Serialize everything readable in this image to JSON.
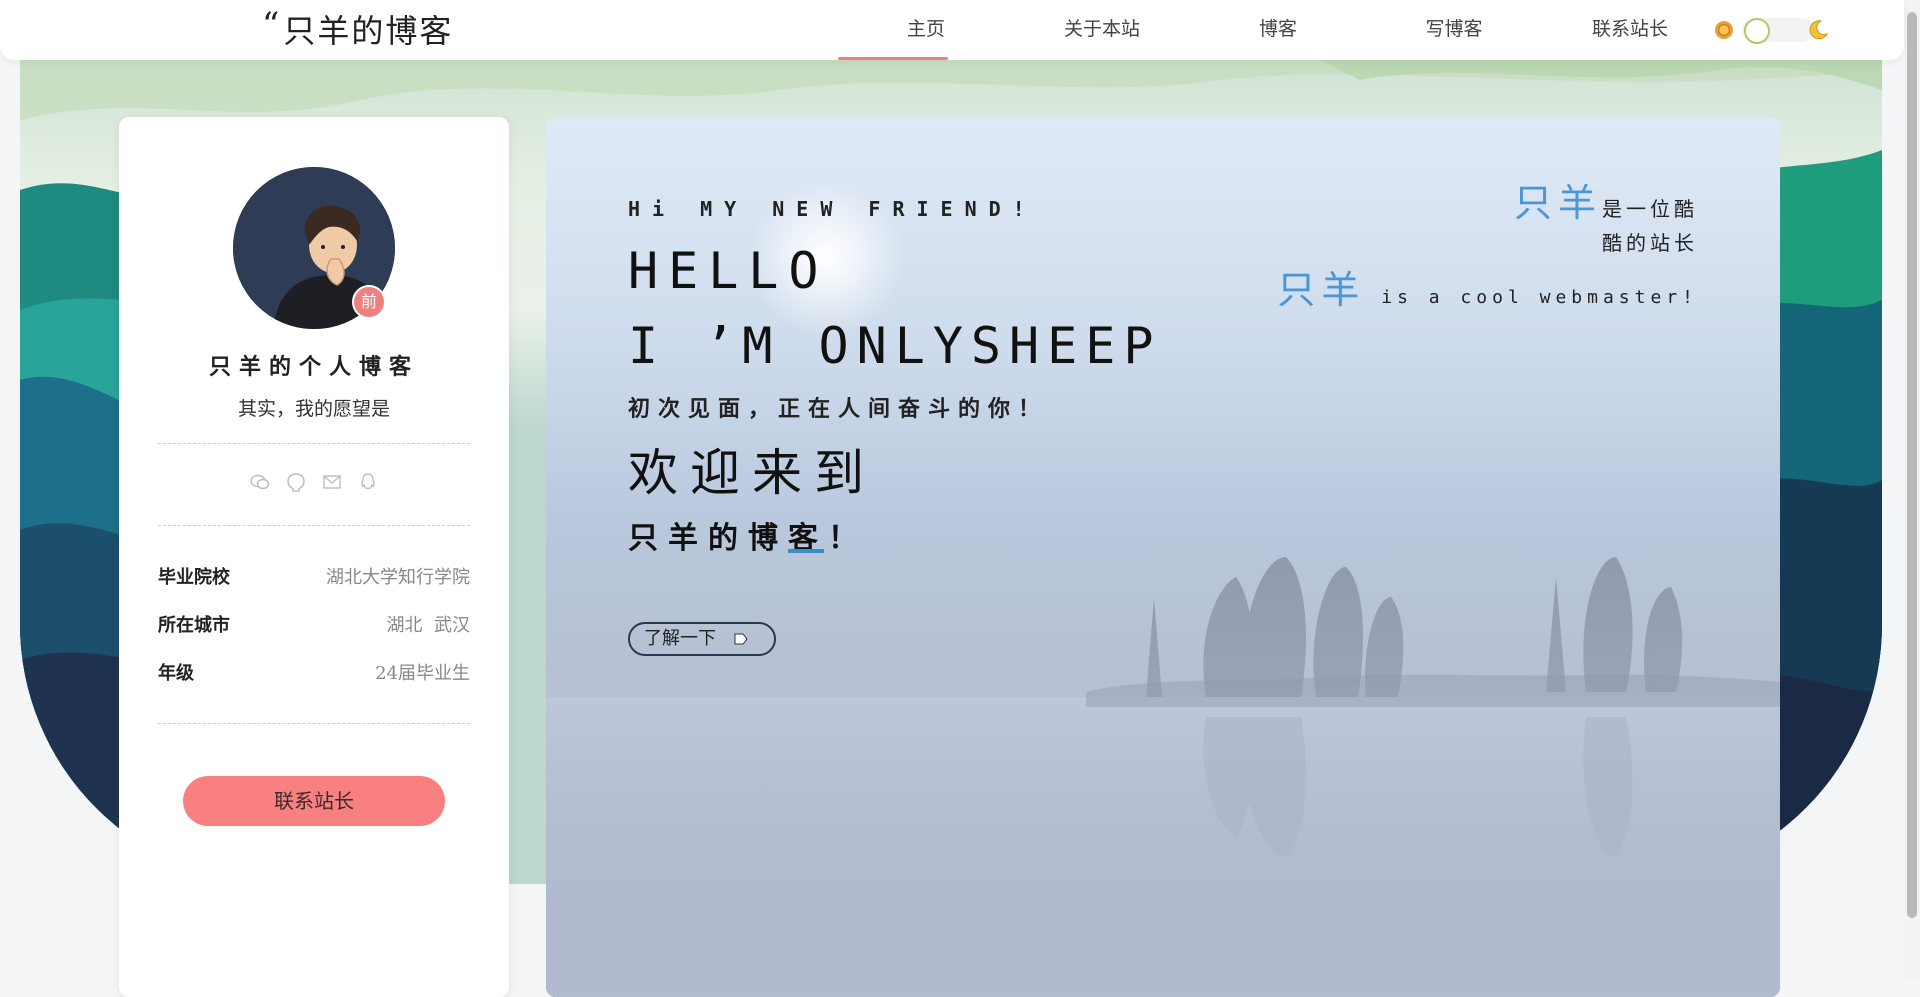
{
  "header": {
    "logo_quote": "“",
    "logo_text": "只羊的博客",
    "nav": [
      {
        "label": "主页",
        "active": true
      },
      {
        "label": "关于本站"
      },
      {
        "label": "博客"
      },
      {
        "label": "写博客"
      },
      {
        "label": "联系站长"
      }
    ],
    "theme_icons": [
      "sun-icon",
      "toggle",
      "moon-icon"
    ]
  },
  "profile": {
    "badge": "前",
    "name": "只羊的个人博客",
    "motto": "其实，我的愿望是",
    "social_icons": [
      "wechat-icon",
      "github-icon",
      "mail-icon",
      "qq-icon"
    ],
    "info": [
      {
        "key": "毕业院校",
        "value": "湖北大学知行学院"
      },
      {
        "key": "所在城市",
        "value": "湖北  武汉"
      },
      {
        "key": "年级",
        "value": "24届毕业生"
      }
    ],
    "contact_button": "联系站长"
  },
  "hero": {
    "greeting": "Hi MY NEW FRIEND!",
    "hello": "HELLO",
    "name_line": "I ’M ONLYSHEEP",
    "subtitle": "初次见面，正在人间奋斗的你！",
    "welcome": "欢迎来到",
    "blog_name": "只羊的博客！",
    "learn_button": "了解一下",
    "tagline": {
      "name_highlight": "只羊",
      "line1_rest": "是一位酷",
      "line2": "酷的站长",
      "line3_rest": "is a cool webmaster!"
    }
  },
  "colors": {
    "accent_pink": "#f98080",
    "accent_blue": "#4b96d6",
    "nav_underline": "#f08080"
  }
}
